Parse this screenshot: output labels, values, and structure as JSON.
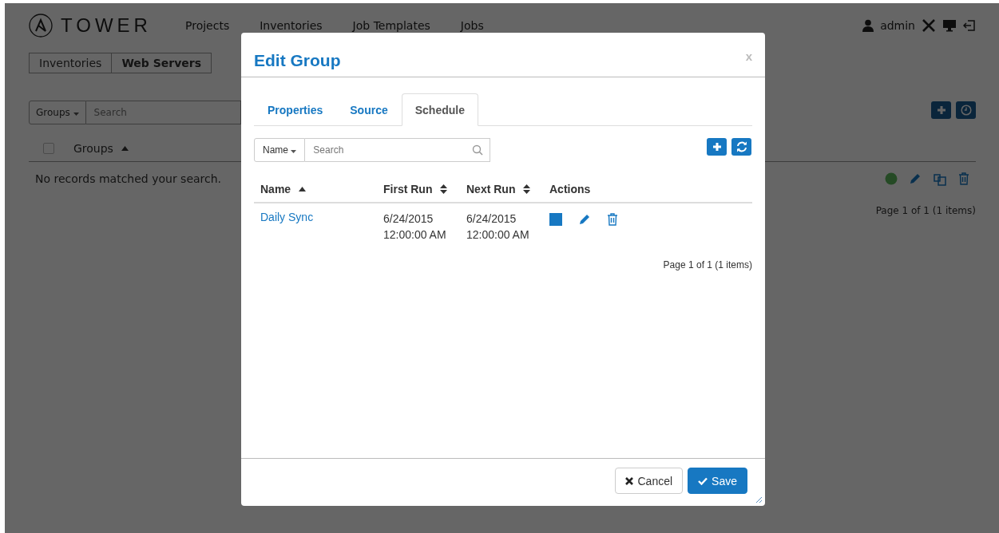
{
  "header": {
    "logo_text": "TOWER",
    "nav": [
      "Projects",
      "Inventories",
      "Job Templates",
      "Jobs"
    ],
    "user": "admin"
  },
  "breadcrumb": [
    "Inventories",
    "Web Servers"
  ],
  "groups_panel": {
    "filter": "Groups",
    "search": {
      "placeholder": "Search"
    },
    "select_all_checked": false,
    "column": "Groups",
    "empty_message": "No records matched your search.",
    "pagination": "Page 1 of 1 (1 items)"
  },
  "modal": {
    "title": "Edit Group",
    "close": "x",
    "tabs": [
      {
        "label": "Properties",
        "selected": false
      },
      {
        "label": "Source",
        "selected": false
      },
      {
        "label": "Schedule",
        "selected": true
      }
    ],
    "filter": "Name",
    "search": {
      "placeholder": "Search"
    },
    "columns": [
      {
        "label": "Name",
        "sortable": true,
        "sorted": true
      },
      {
        "label": "First Run",
        "sortable": true,
        "sorted": false
      },
      {
        "label": "Next Run",
        "sortable": true,
        "sorted": false
      },
      {
        "label": "Actions",
        "sortable": false,
        "sorted": false
      }
    ],
    "rows": [
      {
        "name": "Daily Sync",
        "first_run": [
          "6/24/2015",
          "12:00:00 AM"
        ],
        "next_run": [
          "6/24/2015",
          "12:00:00 AM"
        ]
      }
    ],
    "pagination": "Page 1 of 1 (1 items)",
    "buttons": [
      {
        "label": "Cancel",
        "kind": "default"
      },
      {
        "label": "Save",
        "kind": "primary"
      }
    ]
  }
}
